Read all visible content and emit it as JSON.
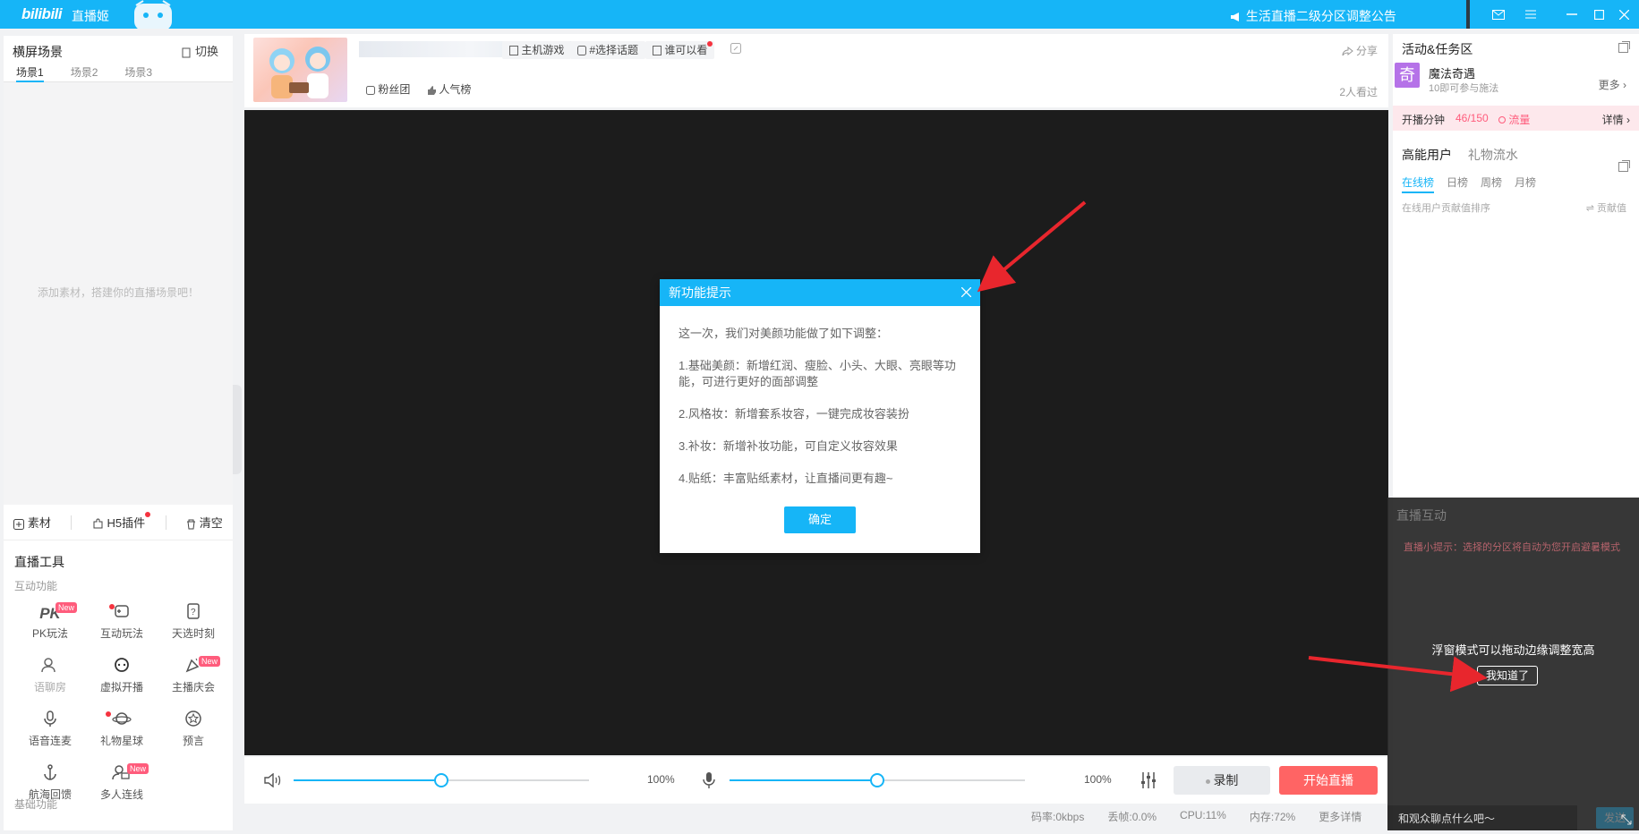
{
  "titlebar": {
    "logo": "bilibili",
    "app_name": "直播姬",
    "notice": "生活直播二级分区调整公告"
  },
  "left": {
    "title": "横屏场景",
    "switch_label": "切换",
    "scene_tabs": [
      "场景1",
      "场景2",
      "场景3"
    ],
    "empty_hint": "添加素材，搭建你的直播场景吧！",
    "actions": {
      "material": "素材",
      "h5": "H5插件",
      "clear": "清空"
    },
    "tools_title": "直播工具",
    "interactive_title": "互动功能",
    "tools": [
      {
        "label": "PK玩法",
        "badge": "New"
      },
      {
        "label": "互动玩法"
      },
      {
        "label": "天选时刻"
      },
      {
        "label": "语聊房"
      },
      {
        "label": "虚拟开播"
      },
      {
        "label": "主播庆会",
        "badge": "New"
      },
      {
        "label": "语音连麦"
      },
      {
        "label": "礼物星球"
      },
      {
        "label": "预言"
      },
      {
        "label": "航海回馈"
      },
      {
        "label": "多人连线",
        "badge": "New"
      }
    ],
    "basic_title": "基础功能"
  },
  "infobar": {
    "category": "主机游戏",
    "topic": "#选择话题",
    "visibility": "谁可以看",
    "fans": "粉丝团",
    "popularity": "人气榜",
    "share": "分享",
    "watchers": "2人看过"
  },
  "controls": {
    "volume_pct": "100%",
    "mic_pct": "100%",
    "volume_level": 0.5,
    "mic_level": 0.5,
    "record": "录制",
    "start_live": "开始直播"
  },
  "statusbar": {
    "bitrate": "码率:0kbps",
    "drop": "丢帧:0.0%",
    "cpu": "CPU:11%",
    "mem": "内存:72%",
    "more": "更多详情"
  },
  "right": {
    "title": "活动&任务区",
    "activity_icon_text": "奇",
    "activity_name": "魔法奇遇",
    "activity_desc": "10即可参与施法",
    "more": "更多",
    "minutes_label": "开播分钟",
    "minutes_value": "46/150",
    "traffic": "流量",
    "details": "详情",
    "tab_active": "高能用户",
    "tab_other": "礼物流水",
    "sub_tabs": [
      "在线榜",
      "日榜",
      "周榜",
      "月榜"
    ],
    "rank_hint": "在线用户贡献值排序",
    "contrib": "贡献值"
  },
  "dark_panel": {
    "title": "直播互动",
    "tip_prefix": "直播小提示：",
    "tip_text": "选择的分区将自动为您开启避暑模式",
    "float_tip": "浮窗模式可以拖动边缘调整宽高",
    "know_btn": "我知道了",
    "chat_placeholder": "和观众聊点什么吧～",
    "send": "发送"
  },
  "modal": {
    "title": "新功能提示",
    "intro": "这一次，我们对美颜功能做了如下调整：",
    "items": [
      "1.基础美颜：新增红润、瘦脸、小头、大眼、亮眼等功能，可进行更好的面部调整",
      "2.风格妆：新增套系妆容，一键完成妆容装扮",
      "3.补妆：新增补妆功能，可自定义妆容效果",
      "4.贴纸：丰富贴纸素材，让直播间更有趣~"
    ],
    "ok": "确定"
  },
  "colors": {
    "accent": "#16b5f7",
    "live": "#ff6464",
    "arrow": "#e8262d"
  }
}
